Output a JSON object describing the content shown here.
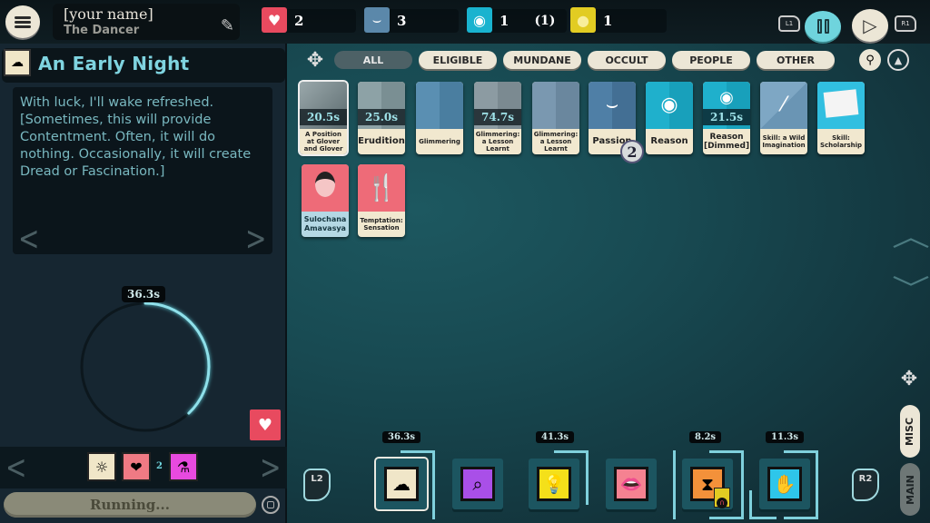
{
  "header": {
    "player_name": "[your name]",
    "player_title": "The Dancer",
    "resources": [
      {
        "name": "Health",
        "icon": "heart-icon",
        "color": "#e84a5f",
        "value": "2"
      },
      {
        "name": "Passion",
        "icon": "closed-eye-icon",
        "color": "#5b88aa",
        "value": "3"
      },
      {
        "name": "Reason",
        "icon": "eye-icon",
        "color": "#19b3cf",
        "value": "1",
        "extra": "(1)"
      },
      {
        "name": "Funds",
        "icon": "coin-icon",
        "color": "#e2cc22",
        "value": "1"
      }
    ],
    "l1_label": "L1",
    "r1_label": "R1",
    "pause_icon": "pause-icon",
    "play_icon": "play-icon"
  },
  "situation": {
    "title": "An Early Night",
    "icon": "dream-icon",
    "description": "With luck, I'll wake refreshed. [Sometimes, this will provide Contentment. Often, it will do nothing. Occasionally, it will create Dread or Fascination.]",
    "prev_arrow": "<",
    "next_arrow": ">",
    "timer": "36.3s",
    "progress_fraction": 0.38,
    "output_card_icon": "heart-icon",
    "aspects": [
      {
        "icon": "insight-icon",
        "color": "#f0e6c8"
      },
      {
        "icon": "anatomical-heart-icon",
        "color": "#ef7a84",
        "count": "2"
      },
      {
        "icon": "potion-icon",
        "color": "#e84adf"
      }
    ],
    "status_button": "Running...",
    "stop_icon": "stop-icon"
  },
  "filters": {
    "tabs": [
      "ALL",
      "ELIGIBLE",
      "MUNDANE",
      "OCCULT",
      "PEOPLE",
      "OTHER"
    ],
    "active": "ALL"
  },
  "cards": [
    {
      "label": "A Position at Glover and Glover",
      "timer": "20.5s",
      "art": "walking-legs",
      "selected": true
    },
    {
      "label": "Erudition",
      "timer": "25.0s",
      "art": "erudition"
    },
    {
      "label": "Glimmering",
      "art": "glimmering"
    },
    {
      "label": "Glimmering: a Lesson Learnt",
      "timer": "74.7s",
      "art": "glimmering"
    },
    {
      "label": "Glimmering: a Lesson Learnt",
      "art": "glimmering"
    },
    {
      "label": "Passion",
      "art": "closed-eye",
      "stack": "2"
    },
    {
      "label": "Reason",
      "art": "eye"
    },
    {
      "label": "Reason [Dimmed]",
      "timer": "21.5s",
      "art": "eye"
    },
    {
      "label": "Skill: a Wild Imagination",
      "art": "brush"
    },
    {
      "label": "Skill: Scholarship",
      "art": "library-card"
    },
    {
      "label": "Sulochana Amavasya",
      "art": "portrait"
    },
    {
      "label": "Temptation: Sensation",
      "art": "fork-knife"
    }
  ],
  "verbs": [
    {
      "name": "dream",
      "icon": "dream-icon",
      "color": "#f0e6c8",
      "timer": "36.3s",
      "selected": true
    },
    {
      "name": "explore",
      "icon": "telescope-icon",
      "color": "#a94fe8"
    },
    {
      "name": "study",
      "icon": "lightbulb-icon",
      "color": "#f4e01a",
      "timer": "41.3s"
    },
    {
      "name": "talk",
      "icon": "lips-icon",
      "color": "#f58291"
    },
    {
      "name": "time",
      "icon": "hourglass-icon",
      "color": "#f3913a",
      "timer": "8.2s"
    },
    {
      "name": "work",
      "icon": "hand-eye-icon",
      "color": "#2ec6ea",
      "timer": "11.3s"
    }
  ],
  "controls": {
    "l2_label": "L2",
    "r2_label": "R2",
    "side_tabs": [
      "MISC",
      "MAIN"
    ],
    "scroll_up": "^",
    "scroll_down": "v"
  }
}
